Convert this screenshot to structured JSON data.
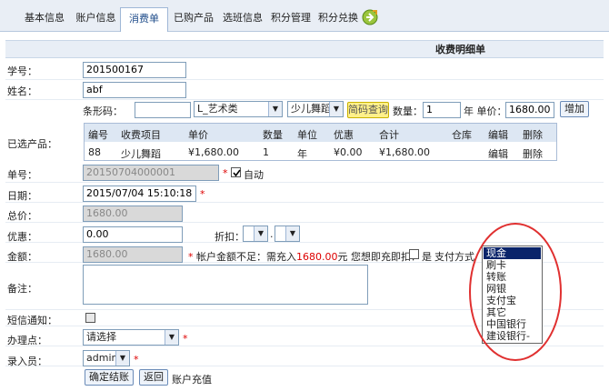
{
  "tabs": [
    "基本信息",
    "账户信息",
    "消费单",
    "已购产品",
    "选班信息",
    "积分管理",
    "积分兑换"
  ],
  "header_title": "收费明细单",
  "form": {
    "student_id_label": "学号：",
    "student_id_value": "201500167",
    "name_label": "姓名：",
    "name_value": "abf",
    "barcode_label": "条形码：",
    "category_select": "L_艺术类",
    "item_select": "少儿舞蹈",
    "barcode_query_btn": "简码查询",
    "qty_label": "数量：",
    "qty_value": "1",
    "price_label": "年 单价：",
    "price_value": "1680.00",
    "add_btn": "增加",
    "selected_label": "已选产品：",
    "order_no_label": "单号：",
    "order_no_value": "20150704000001",
    "auto_label": "自动",
    "date_label": "日期：",
    "date_value": "2015/07/04 15:10:18",
    "total_label": "总价：",
    "total_value": "1680.00",
    "discount_label": "优惠：",
    "discount_value": "0.00",
    "rebate_label": "折扣：",
    "rebate_dot": ".",
    "amount_label": "金额：",
    "amount_value": "1680.00",
    "insufficient_pre": "帐户金额不足：需充入",
    "insufficient_amount": "1680.00",
    "insufficient_post": "元 您想即充即扣？",
    "yes_label": "是",
    "pay_method_label": "支付方式",
    "remark_label": "备注：",
    "sms_label": "短信通知：",
    "branch_label": "办理点：",
    "branch_select": "请选择",
    "operator_label": "录入员：",
    "operator_select": "admin",
    "confirm_btn": "确定结账",
    "back_btn": "返回",
    "recharge_link": "账户充值"
  },
  "product_table": {
    "headers": [
      "编号",
      "收费项目",
      "单价",
      "数量",
      "单位",
      "优惠",
      "合计",
      "仓库",
      "编辑",
      "删除"
    ],
    "row": [
      "88",
      "少儿舞蹈",
      "¥1,680.00",
      "1",
      "年",
      "¥0.00",
      "¥1,680.00",
      "",
      "编辑",
      "删除"
    ]
  },
  "payment_options": [
    "现金",
    "刷卡",
    "转账",
    "网银",
    "支付宝",
    "其它",
    "中国银行",
    "建设银行-"
  ],
  "colors": {
    "accent": "#1f4c8a",
    "required": "#dd0000",
    "highlight": "#e03030"
  }
}
